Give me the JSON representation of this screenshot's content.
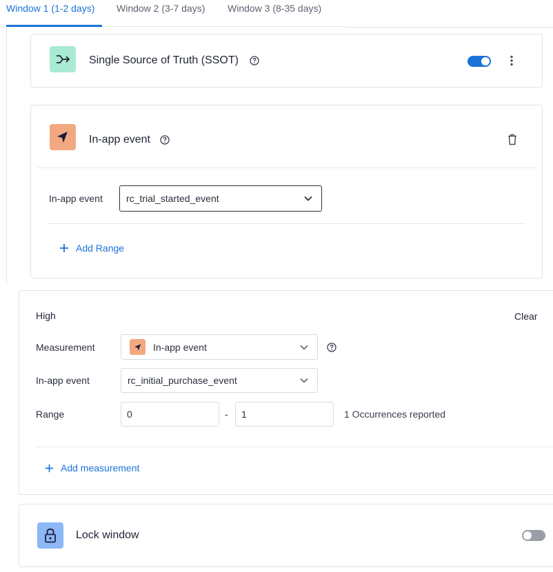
{
  "tabs": [
    {
      "label": "Window 1 (1-2 days)"
    },
    {
      "label": "Window 2 (3-7 days)"
    },
    {
      "label": "Window 3 (8-35 days)"
    }
  ],
  "ssot": {
    "title": "Single Source of Truth (SSOT)",
    "icon": "merge-arrows-icon",
    "icon_bg": "#a8ead2",
    "enabled": true
  },
  "inapp_card": {
    "title": "In-app event",
    "icon": "navigation-arrow-icon",
    "icon_bg": "#f2a980",
    "field_label": "In-app event",
    "field_value": "rc_trial_started_event",
    "add_range_label": "Add Range"
  },
  "high_card": {
    "title": "High",
    "clear_label": "Clear",
    "measurement_label": "Measurement",
    "measurement_value": "In-app event",
    "inapp_label": "In-app event",
    "inapp_value": "rc_initial_purchase_event",
    "range_label": "Range",
    "range_from": "0",
    "range_sep": "-",
    "range_to": "1",
    "occurrences_text": "1 Occurrences reported",
    "add_measurement_label": "Add measurement"
  },
  "lock": {
    "title": "Lock window",
    "icon": "lock-icon",
    "icon_bg": "#8cb8f5",
    "enabled": false
  },
  "colors": {
    "accent": "#1a73d9",
    "toggle_off": "#9a9ea6"
  }
}
